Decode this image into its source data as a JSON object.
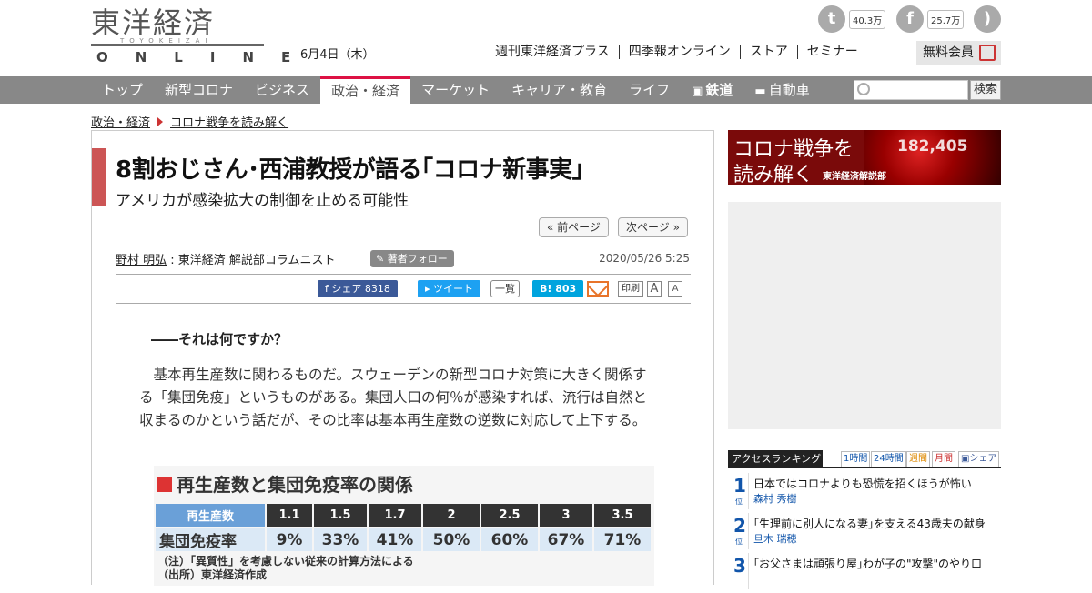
{
  "header": {
    "logo_kanji": "東洋経済",
    "logo_roman": "TOYOKEIZAI",
    "logo_online": "ONLINE",
    "date": "6月4日（木）",
    "links": [
      "週刊東洋経済プラス",
      "四季報オンライン",
      "ストア",
      "セミナー"
    ],
    "member_label": "無料会員",
    "social": [
      {
        "icon": "twitter-icon",
        "glyph": "t",
        "count": "40.3万"
      },
      {
        "icon": "facebook-icon",
        "glyph": "f",
        "count": "25.7万"
      },
      {
        "icon": "rss-icon",
        "glyph": ")",
        "count": ""
      }
    ]
  },
  "gnav": {
    "items": [
      "トップ",
      "新型コロナ",
      "ビジネス",
      "政治・経済",
      "マーケット",
      "キャリア・教育",
      "ライフ",
      "鉄道",
      "自動車"
    ],
    "active": "政治・経済",
    "search_button": "検索"
  },
  "breadcrumb": [
    "政治・経済",
    "コロナ戦争を読み解く"
  ],
  "article": {
    "title": "8割おじさん･西浦教授が語る｢コロナ新事実｣",
    "subtitle": "アメリカが感染拡大の制御を止める可能性",
    "prev_page": "« 前ページ",
    "next_page": "次ページ »",
    "author_name": "野村 明弘",
    "author_role": " : 東洋経済 解説部コラムニスト",
    "follow_label": "著者フォロー",
    "published": "2020/05/26 5:25",
    "share_fb": "シェア 8318",
    "share_tw": "ツイート",
    "share_list": "一覧",
    "share_hatena": "B! 803",
    "print_label": "印刷",
    "font_large": "A",
    "font_small": "A",
    "question": "――それは何ですか？",
    "paragraph": "基本再生産数に関わるものだ。スウェーデンの新型コロナ対策に大きく関係する「集団免疫」というものがある。集団人口の何％が感染すれば、流行は自然と収まるのかという話だが、その比率は基本再生産数の逆数に対応して上下する。"
  },
  "figure": {
    "title": "再生産数と集団免疫率の関係",
    "header_label": "再生産数",
    "row_label": "集団免疫率",
    "r_values": [
      "1.1",
      "1.5",
      "1.7",
      "2",
      "2.5",
      "3",
      "3.5"
    ],
    "immunity": [
      "9%",
      "33%",
      "41%",
      "50%",
      "60%",
      "67%",
      "71%"
    ],
    "note1": "（注）「異質性」を考慮しない従来の計算方法による",
    "note2": "（出所）東洋経済作成"
  },
  "sidebar": {
    "banner_line1": "コロナ戦争を",
    "banner_line2": "読み解く",
    "banner_sub": "東洋経済解説部",
    "banner_number": "182,405",
    "ranking_title": "アクセスランキング",
    "ranking_tabs": [
      "1時間",
      "24時間",
      "週間",
      "月間",
      "シェア"
    ],
    "ranking": [
      {
        "no": "1",
        "unit": "位",
        "headline": "日本ではコロナよりも恐慌を招くほうが怖い",
        "author": "森村 秀樹"
      },
      {
        "no": "2",
        "unit": "位",
        "headline": "｢生理前に別人になる妻｣を支える43歳夫の献身",
        "author": "旦木 瑞穂"
      },
      {
        "no": "3",
        "unit": "位",
        "headline": "｢お父さまは頑張り屋｣わが子の\"攻撃\"のやり口",
        "author": ""
      }
    ]
  }
}
